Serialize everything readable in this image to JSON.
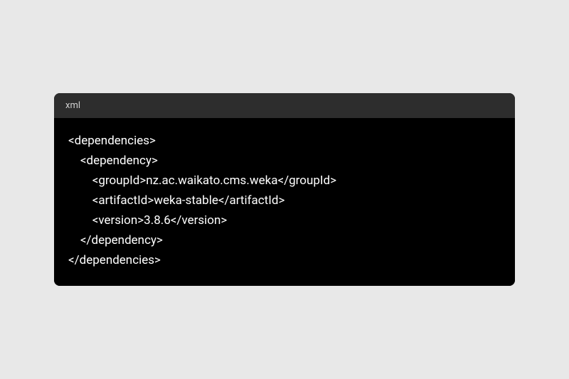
{
  "code_block": {
    "language": "xml",
    "lines": [
      "<dependencies>",
      "    <dependency>",
      "        <groupId>nz.ac.waikato.cms.weka</groupId>",
      "        <artifactId>weka-stable</artifactId>",
      "        <version>3.8.6</version>",
      "    </dependency>",
      "</dependencies>"
    ]
  }
}
